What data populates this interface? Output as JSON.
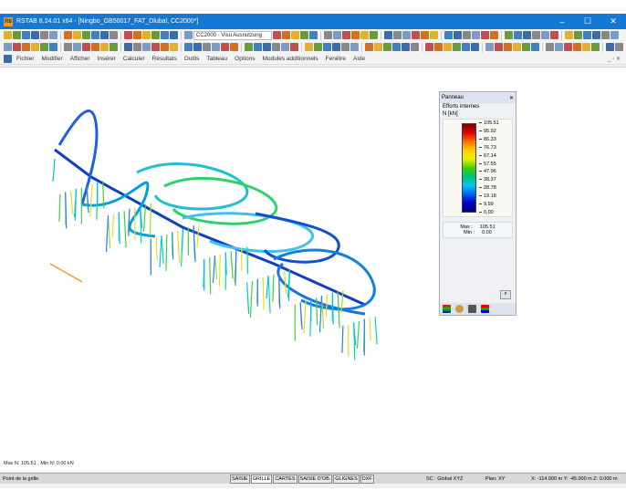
{
  "window": {
    "title": "RSTAB 8.24.01 x64 - [Ningbo_GB50017_FAT_Dlubal, CC2000*]",
    "app_icon": "R8",
    "minimize": "–",
    "maximize": "☐",
    "close": "✕"
  },
  "toolbar": {
    "combo_value": "CC2000 - Visu Ausnutzung"
  },
  "menu": [
    "Fichier",
    "Modifier",
    "Afficher",
    "Insérer",
    "Calculer",
    "Résultats",
    "Outils",
    "Tableau",
    "Options",
    "Modules additionnels",
    "Fenêtre",
    "Aide"
  ],
  "mdi_controls": "_ ▫ ✕",
  "canvas": {
    "info": "Max N: 105.51 , Min N: 0.00 kN"
  },
  "panel": {
    "title": "Panneau",
    "close": "✕",
    "heading": "Efforts internes",
    "unit": "N [kN]",
    "legend": [
      "105.51",
      "95.92",
      "86.33",
      "76.73",
      "67.14",
      "57.55",
      "47.96",
      "38.37",
      "28.78",
      "19.18",
      "9.59",
      "0.00"
    ],
    "max_label": "Max :",
    "max_value": "105.51",
    "min_label": "Min :",
    "min_value": "0.00"
  },
  "status": {
    "left": "Point de la grille",
    "buttons": [
      {
        "label": "SAISIE",
        "on": false
      },
      {
        "label": "GRILLE",
        "on": true
      },
      {
        "label": "CARTES",
        "on": false
      },
      {
        "label": "SAISIE D'OB.",
        "on": false
      },
      {
        "label": "GLIGNES",
        "on": false
      },
      {
        "label": "DXF",
        "on": false
      }
    ],
    "sc": "SC : Global XYZ",
    "plan": "Plan: XY",
    "coords": "X: -114.000 m  Y: -45.000 m  Z: 0.000 m"
  }
}
